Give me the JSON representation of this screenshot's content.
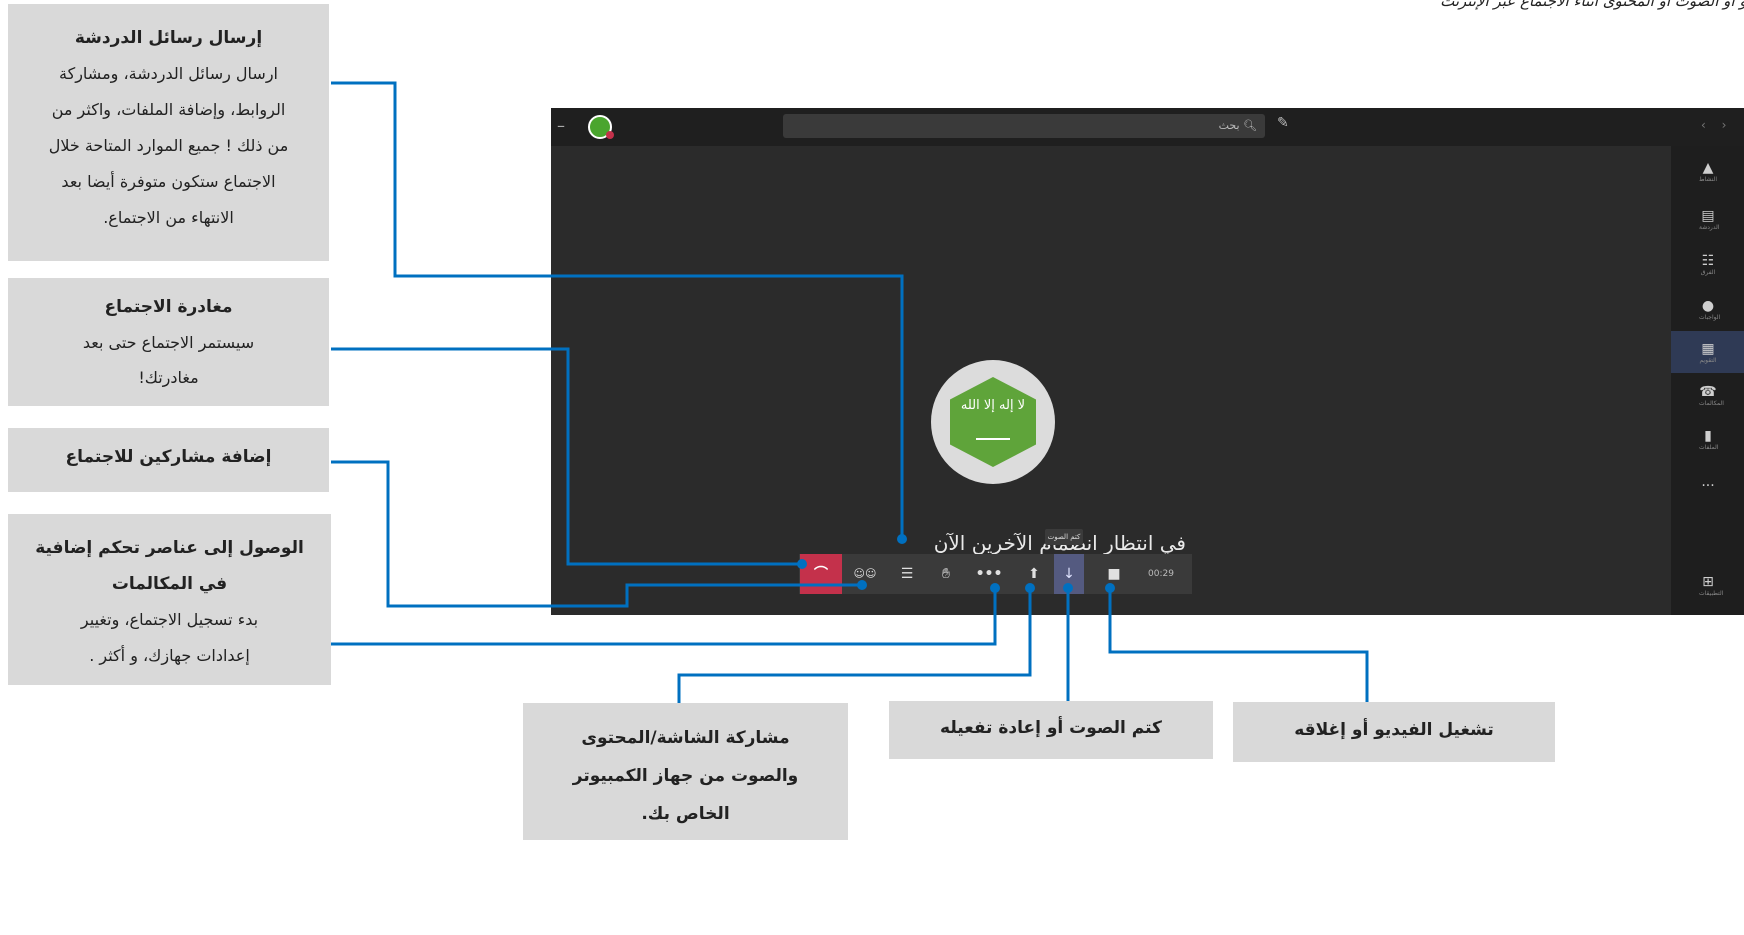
{
  "top_caption": "الفيديو أو الصوت أو المحتوى أثناء الاجتماع عبر الإنترنت",
  "callouts": {
    "chat": {
      "title": "إرسال رسائل الدردشة",
      "lines": [
        "ارسال رسائل الدردشة، ومشاركة",
        "الروابط، وإضافة الملفات، واكثر من",
        "من ذلك ! جميع الموارد المتاحة خلال",
        "الاجتماع ستكون متوفرة أيضا بعد",
        "الانتهاء من الاجتماع."
      ]
    },
    "leave": {
      "title": "مغادرة الاجتماع",
      "lines": [
        "سيستمر الاجتماع حتى بعد",
        "مغادرتك!"
      ]
    },
    "add_participants": {
      "title": "إضافة مشاركين للاجتماع"
    },
    "more_controls": {
      "title_lines": [
        "الوصول إلى عناصر تحكم إضافية",
        "في المكالمات"
      ],
      "lines": [
        "بدء تسجيل الاجتماع، وتغيير",
        "إعدادات جهازك، و أكثر ."
      ]
    },
    "share": {
      "title_lines": [
        "مشاركة الشاشة/المحتوى",
        "والصوت من جهاز الكمبيوتر",
        "الخاص بك."
      ]
    },
    "mute": {
      "title": "كتم الصوت أو إعادة تفعيله"
    },
    "video": {
      "title": "تشغيل الفيديو أو إغلاقه"
    }
  },
  "teams": {
    "search_placeholder": "بحث",
    "rail_items": [
      "النشاط",
      "الدردشة",
      "الفرق",
      "الواجبات",
      "التقويم",
      "المكالمات",
      "الملفات",
      "...",
      "التطبيقات"
    ],
    "waiting_text": "في انتظار انضمام الآخرين الآن",
    "mic_tooltip": "كتم الصوت",
    "timer": "00:29",
    "flag_script": "لا إله إلا الله"
  },
  "colors": {
    "callout_bg": "#d9d9d9",
    "connector": "#0070c0",
    "hangup": "#c4314b",
    "avatar_green": "#5fa43a"
  },
  "icons": [
    "hangup-icon",
    "participants-icon",
    "chat-icon",
    "raise-hand-icon",
    "more-options-icon",
    "share-screen-icon",
    "mic-icon",
    "video-icon",
    "search-icon",
    "compose-icon"
  ]
}
